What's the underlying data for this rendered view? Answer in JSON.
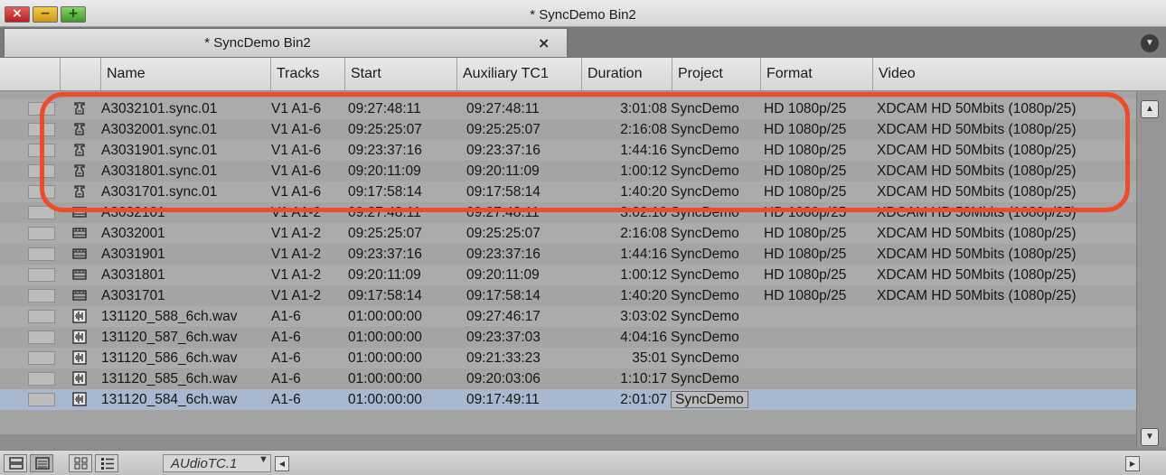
{
  "window": {
    "title": "* SyncDemo Bin2",
    "close_glyph": "×",
    "minimize_glyph": "−",
    "maximize_glyph": "+"
  },
  "tabs": [
    {
      "label": "* SyncDemo Bin2",
      "close_glyph": "×",
      "active": true
    }
  ],
  "tab_menu_glyph": "▼",
  "columns": [
    "",
    "",
    "Name",
    "Tracks",
    "Start",
    "Auxiliary TC1",
    "Duration",
    "Project",
    "Format",
    "Video"
  ],
  "rows": [
    {
      "type": "sync",
      "name": "A3032101.sync.01",
      "tracks": "V1 A1-6",
      "start": "09:27:48:11",
      "aux_tc1": "09:27:48:11",
      "duration": "3:01:08",
      "project": "SyncDemo",
      "format": "HD 1080p/25",
      "video": "XDCAM HD 50Mbits (1080p/25)"
    },
    {
      "type": "sync",
      "name": "A3032001.sync.01",
      "tracks": "V1 A1-6",
      "start": "09:25:25:07",
      "aux_tc1": "09:25:25:07",
      "duration": "2:16:08",
      "project": "SyncDemo",
      "format": "HD 1080p/25",
      "video": "XDCAM HD 50Mbits (1080p/25)"
    },
    {
      "type": "sync",
      "name": "A3031901.sync.01",
      "tracks": "V1 A1-6",
      "start": "09:23:37:16",
      "aux_tc1": "09:23:37:16",
      "duration": "1:44:16",
      "project": "SyncDemo",
      "format": "HD 1080p/25",
      "video": "XDCAM HD 50Mbits (1080p/25)"
    },
    {
      "type": "sync",
      "name": "A3031801.sync.01",
      "tracks": "V1 A1-6",
      "start": "09:20:11:09",
      "aux_tc1": "09:20:11:09",
      "duration": "1:00:12",
      "project": "SyncDemo",
      "format": "HD 1080p/25",
      "video": "XDCAM HD 50Mbits (1080p/25)"
    },
    {
      "type": "sync",
      "name": "A3031701.sync.01",
      "tracks": "V1 A1-6",
      "start": "09:17:58:14",
      "aux_tc1": "09:17:58:14",
      "duration": "1:40:20",
      "project": "SyncDemo",
      "format": "HD 1080p/25",
      "video": "XDCAM HD 50Mbits (1080p/25)"
    },
    {
      "type": "video",
      "name": "A3032101",
      "tracks": "V1 A1-2",
      "start": "09:27:48:11",
      "aux_tc1": "09:27:48:11",
      "duration": "3:02:10",
      "project": "SyncDemo",
      "format": "HD 1080p/25",
      "video": "XDCAM HD 50Mbits (1080p/25)"
    },
    {
      "type": "video",
      "name": "A3032001",
      "tracks": "V1 A1-2",
      "start": "09:25:25:07",
      "aux_tc1": "09:25:25:07",
      "duration": "2:16:08",
      "project": "SyncDemo",
      "format": "HD 1080p/25",
      "video": "XDCAM HD 50Mbits (1080p/25)"
    },
    {
      "type": "video",
      "name": "A3031901",
      "tracks": "V1 A1-2",
      "start": "09:23:37:16",
      "aux_tc1": "09:23:37:16",
      "duration": "1:44:16",
      "project": "SyncDemo",
      "format": "HD 1080p/25",
      "video": "XDCAM HD 50Mbits (1080p/25)"
    },
    {
      "type": "video",
      "name": "A3031801",
      "tracks": "V1 A1-2",
      "start": "09:20:11:09",
      "aux_tc1": "09:20:11:09",
      "duration": "1:00:12",
      "project": "SyncDemo",
      "format": "HD 1080p/25",
      "video": "XDCAM HD 50Mbits (1080p/25)"
    },
    {
      "type": "video",
      "name": "A3031701",
      "tracks": "V1 A1-2",
      "start": "09:17:58:14",
      "aux_tc1": "09:17:58:14",
      "duration": "1:40:20",
      "project": "SyncDemo",
      "format": "HD 1080p/25",
      "video": "XDCAM HD 50Mbits (1080p/25)"
    },
    {
      "type": "audio",
      "name": "131120_588_6ch.wav",
      "tracks": "A1-6",
      "start": "01:00:00:00",
      "aux_tc1": "09:27:46:17",
      "duration": "3:03:02",
      "project": "SyncDemo",
      "format": "",
      "video": ""
    },
    {
      "type": "audio",
      "name": "131120_587_6ch.wav",
      "tracks": "A1-6",
      "start": "01:00:00:00",
      "aux_tc1": "09:23:37:03",
      "duration": "4:04:16",
      "project": "SyncDemo",
      "format": "",
      "video": ""
    },
    {
      "type": "audio",
      "name": "131120_586_6ch.wav",
      "tracks": "A1-6",
      "start": "01:00:00:00",
      "aux_tc1": "09:21:33:23",
      "duration": "35:01",
      "project": "SyncDemo",
      "format": "",
      "video": ""
    },
    {
      "type": "audio",
      "name": "131120_585_6ch.wav",
      "tracks": "A1-6",
      "start": "01:00:00:00",
      "aux_tc1": "09:20:03:06",
      "duration": "1:10:17",
      "project": "SyncDemo",
      "format": "",
      "video": ""
    },
    {
      "type": "audio",
      "name": "131120_584_6ch.wav",
      "tracks": "A1-6",
      "start": "01:00:00:00",
      "aux_tc1": "09:17:49:11",
      "duration": "2:01:07",
      "project": "SyncDemo",
      "format": "",
      "video": "",
      "selected": true
    }
  ],
  "footer": {
    "view_name": "AUdioTC.1",
    "view_caret": "▼"
  },
  "scroll": {
    "up_glyph": "▲",
    "down_glyph": "▼",
    "left_glyph": "◀",
    "right_glyph": "▶"
  },
  "colors": {
    "highlight": "#ee4b2b",
    "selected_row": "#a7b8cf"
  }
}
